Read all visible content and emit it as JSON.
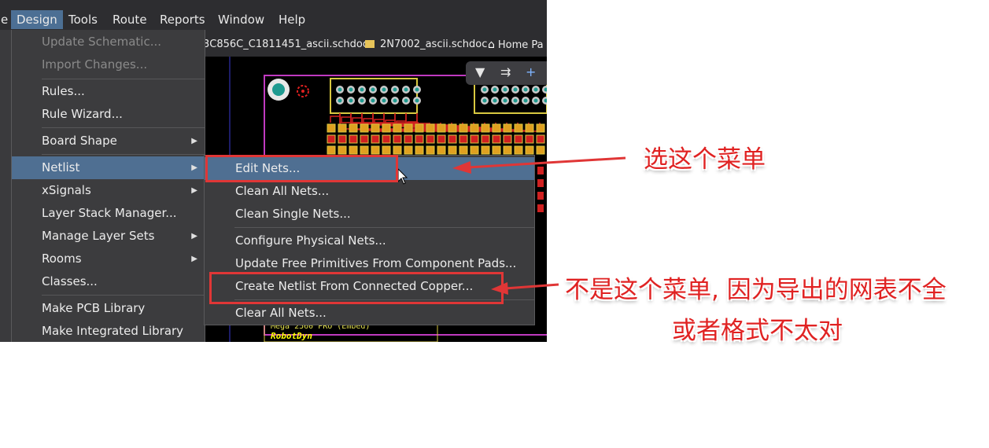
{
  "menubar": {
    "items": [
      {
        "label": "e"
      },
      {
        "label": "Design"
      },
      {
        "label": "Tools"
      },
      {
        "label": "Route"
      },
      {
        "label": "Reports"
      },
      {
        "label": "Window"
      },
      {
        "label": "Help"
      }
    ]
  },
  "tabs": [
    {
      "label": "3C856C_C1811451_ascii.schdoc"
    },
    {
      "label": "2N7002_ascii.schdoc"
    },
    {
      "label": "Home Pa"
    }
  ],
  "design_menu": {
    "items": [
      {
        "label": "Update Schematic...",
        "disabled": true
      },
      {
        "label": "Import Changes...",
        "disabled": true
      },
      {
        "label": "Rules..."
      },
      {
        "label": "Rule Wizard..."
      },
      {
        "label": "Board Shape",
        "submenu": true
      },
      {
        "label": "Netlist",
        "submenu": true,
        "highlighted": true
      },
      {
        "label": "xSignals",
        "submenu": true
      },
      {
        "label": "Layer Stack Manager..."
      },
      {
        "label": "Manage Layer Sets",
        "submenu": true
      },
      {
        "label": "Rooms",
        "submenu": true
      },
      {
        "label": "Classes..."
      },
      {
        "label": "Make PCB Library"
      },
      {
        "label": "Make Integrated Library"
      }
    ]
  },
  "netlist_menu": {
    "items": [
      {
        "label": "Edit Nets...",
        "highlighted": true
      },
      {
        "label": "Clean All Nets..."
      },
      {
        "label": "Clean Single Nets..."
      },
      {
        "label": "Configure Physical Nets..."
      },
      {
        "label": "Update Free Primitives From Component Pads..."
      },
      {
        "label": "Create Netlist From Connected Copper..."
      },
      {
        "label": "Clear All Nets..."
      }
    ]
  },
  "pcb": {
    "silkscreen_line1": "Mega 2560 PRO (Embed)",
    "silkscreen_line2": "RobotDyn"
  },
  "pcb_toolbar": {
    "icons": [
      "filter-icon",
      "route-icon",
      "plus-icon"
    ]
  },
  "annotations": {
    "select_this": "选这个菜单",
    "not_this_line1": "不是这个菜单, 因为导出的网表不全",
    "not_this_line2": "或者格式不太对",
    "color": "#e03636"
  },
  "colors": {
    "menu_bg": "#3c3c3e",
    "highlight": "#4f6f92",
    "app_bg": "#2d2d30"
  }
}
